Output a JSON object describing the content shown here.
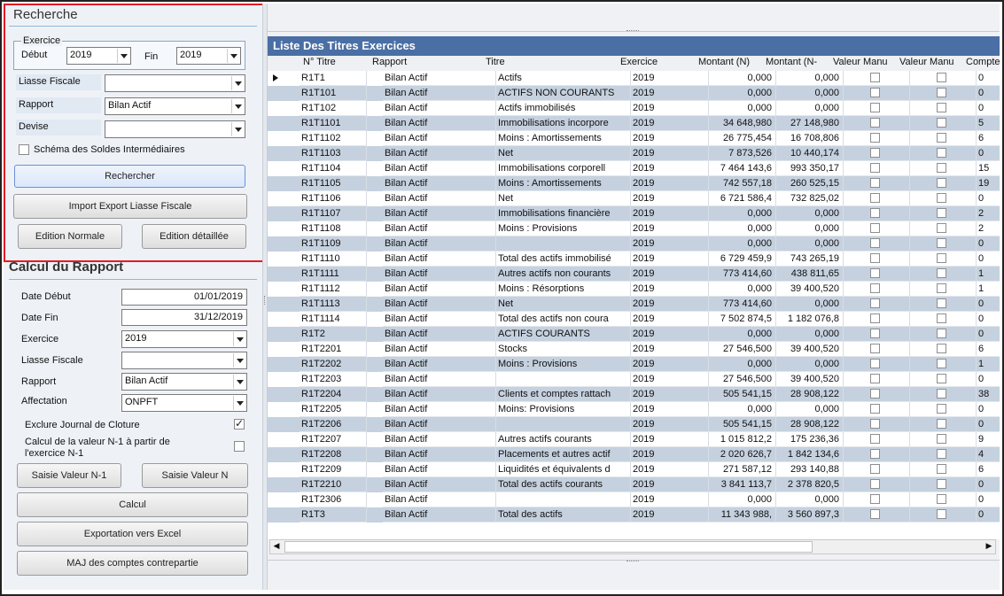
{
  "recherche": {
    "title": "Recherche",
    "exercice_legend": "Exercice",
    "debut_label": "Début",
    "debut_value": "2019",
    "fin_label": "Fin",
    "fin_value": "2019",
    "liasse_label": "Liasse Fiscale",
    "liasse_value": "",
    "rapport_label": "Rapport",
    "rapport_value": "Bilan Actif",
    "devise_label": "Devise",
    "devise_value": "",
    "schema_label": "Schéma des Soldes Intermédiaires",
    "rechercher_button": "Rechercher",
    "import_export_button": "Import Export Liasse Fiscale",
    "edition_normale_button": "Edition Normale",
    "edition_detaillee_button": "Edition détaillée"
  },
  "calcul": {
    "title": "Calcul du Rapport",
    "date_debut_label": "Date Début",
    "date_debut_value": "01/01/2019",
    "date_fin_label": "Date Fin",
    "date_fin_value": "31/12/2019",
    "exercice_label": "Exercice",
    "exercice_value": "2019",
    "liasse_label": "Liasse Fiscale",
    "liasse_value": "",
    "rapport_label": "Rapport",
    "rapport_value": "Bilan Actif",
    "affectation_label": "Affectation",
    "affectation_value": "ONPFT",
    "exclure_label": "Exclure Journal de Cloture",
    "exclure_checked": true,
    "calcul_n1_label_line1": "Calcul de la valeur N-1 à partir de",
    "calcul_n1_label_line2": "l'exercice N-1",
    "calcul_n1_checked": false,
    "saisie_n1_button": "Saisie Valeur N-1",
    "saisie_n_button": "Saisie Valeur N",
    "calcul_button": "Calcul",
    "export_excel_button": "Exportation vers Excel",
    "maj_button": "MAJ des comptes contrepartie"
  },
  "grid": {
    "title": "Liste Des Titres  Exercices",
    "columns": [
      "N° Titre",
      "Rapport",
      "Titre",
      "Exercice",
      "Montant (N)",
      "Montant (N-",
      "Valeur Manu",
      "Valeur Manu",
      "Compte"
    ],
    "rows": [
      [
        "R1T1",
        "Bilan Actif",
        "Actifs",
        "2019",
        "0,000",
        "0,000",
        "0"
      ],
      [
        "R1T101",
        "Bilan Actif",
        "ACTIFS NON COURANTS",
        "2019",
        "0,000",
        "0,000",
        "0"
      ],
      [
        "R1T102",
        "Bilan Actif",
        "Actifs immobilisés",
        "2019",
        "0,000",
        "0,000",
        "0"
      ],
      [
        "R1T1101",
        "Bilan Actif",
        "Immobilisations incorpore",
        "2019",
        "34 648,980",
        "27 148,980",
        "5"
      ],
      [
        "R1T1102",
        "Bilan Actif",
        "Moins : Amortissements",
        "2019",
        "26 775,454",
        "16 708,806",
        "6"
      ],
      [
        "R1T1103",
        "Bilan Actif",
        "Net",
        "2019",
        "7 873,526",
        "10 440,174",
        "0"
      ],
      [
        "R1T1104",
        "Bilan Actif",
        "Immobilisations corporell",
        "2019",
        "7 464 143,6",
        "993 350,17",
        "15"
      ],
      [
        "R1T1105",
        "Bilan Actif",
        "Moins : Amortissements",
        "2019",
        "742 557,18",
        "260 525,15",
        "19"
      ],
      [
        "R1T1106",
        "Bilan Actif",
        "Net",
        "2019",
        "6 721 586,4",
        "732 825,02",
        "0"
      ],
      [
        "R1T1107",
        "Bilan Actif",
        "Immobilisations financière",
        "2019",
        "0,000",
        "0,000",
        "2"
      ],
      [
        "R1T1108",
        "Bilan Actif",
        "Moins : Provisions",
        "2019",
        "0,000",
        "0,000",
        "2"
      ],
      [
        "R1T1109",
        "Bilan Actif",
        "",
        "2019",
        "0,000",
        "0,000",
        "0"
      ],
      [
        "R1T1110",
        "Bilan Actif",
        "Total des actifs immobilisé",
        "2019",
        "6 729 459,9",
        "743 265,19",
        "0"
      ],
      [
        "R1T1111",
        "Bilan Actif",
        "Autres actifs non courants",
        "2019",
        "773 414,60",
        "438 811,65",
        "1"
      ],
      [
        "R1T1112",
        "Bilan Actif",
        "Moins : Résorptions",
        "2019",
        "0,000",
        "39 400,520",
        "1"
      ],
      [
        "R1T1113",
        "Bilan Actif",
        "Net",
        "2019",
        "773 414,60",
        "0,000",
        "0"
      ],
      [
        "R1T1114",
        "Bilan Actif",
        "Total des actifs non coura",
        "2019",
        "7 502 874,5",
        "1 182 076,8",
        "0"
      ],
      [
        "R1T2",
        "Bilan Actif",
        "ACTIFS COURANTS",
        "2019",
        "0,000",
        "0,000",
        "0"
      ],
      [
        "R1T2201",
        "Bilan Actif",
        "Stocks",
        "2019",
        "27 546,500",
        "39 400,520",
        "6"
      ],
      [
        "R1T2202",
        "Bilan Actif",
        "Moins : Provisions",
        "2019",
        "0,000",
        "0,000",
        "1"
      ],
      [
        "R1T2203",
        "Bilan Actif",
        "",
        "2019",
        "27 546,500",
        "39 400,520",
        "0"
      ],
      [
        "R1T2204",
        "Bilan Actif",
        "Clients et comptes rattach",
        "2019",
        "505 541,15",
        "28 908,122",
        "38"
      ],
      [
        "R1T2205",
        "Bilan Actif",
        "Moins: Provisions",
        "2019",
        "0,000",
        "0,000",
        "0"
      ],
      [
        "R1T2206",
        "Bilan Actif",
        "",
        "2019",
        "505 541,15",
        "28 908,122",
        "0"
      ],
      [
        "R1T2207",
        "Bilan Actif",
        "Autres actifs courants",
        "2019",
        "1 015 812,2",
        "175 236,36",
        "9"
      ],
      [
        "R1T2208",
        "Bilan Actif",
        "Placements et autres actif",
        "2019",
        "2 020 626,7",
        "1 842 134,6",
        "4"
      ],
      [
        "R1T2209",
        "Bilan Actif",
        "Liquidités et équivalents d",
        "2019",
        "271 587,12",
        "293 140,88",
        "6"
      ],
      [
        "R1T2210",
        "Bilan Actif",
        "Total des actifs courants",
        "2019",
        "3 841 113,7",
        "2 378 820,5",
        "0"
      ],
      [
        "R1T2306",
        "Bilan Actif",
        "",
        "2019",
        "0,000",
        "0,000",
        "0"
      ],
      [
        "R1T3",
        "Bilan Actif",
        "Total des actifs",
        "2019",
        "11 343 988,",
        "3 560 897,3",
        "0"
      ]
    ]
  }
}
